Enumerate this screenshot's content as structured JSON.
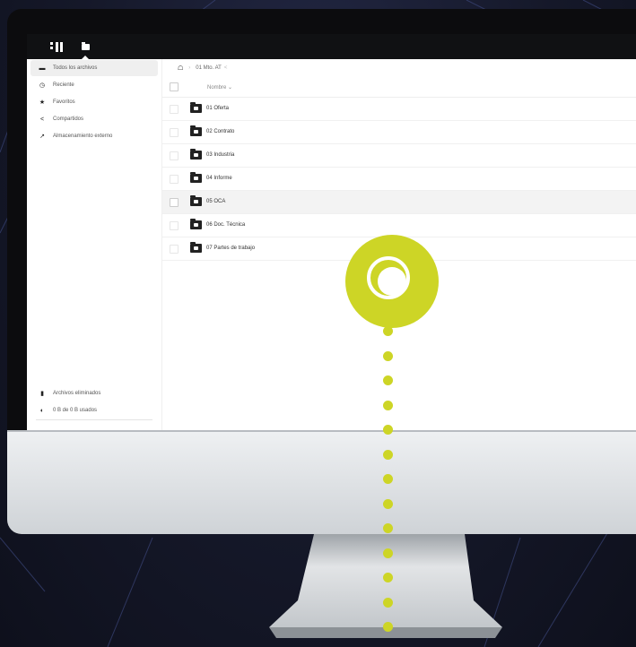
{
  "sidebar": {
    "items": [
      {
        "label": "Todos los archivos",
        "icon": "folder-icon",
        "active": true
      },
      {
        "label": "Reciente",
        "icon": "clock-icon"
      },
      {
        "label": "Favoritos",
        "icon": "star-icon"
      },
      {
        "label": "Compartidos",
        "icon": "share-icon"
      },
      {
        "label": "Almacenamiento externo",
        "icon": "external-icon"
      }
    ],
    "trash_label": "Archivos eliminados",
    "quota_label": "0 B de 0 B usados"
  },
  "breadcrumb": {
    "current": "01 Mto. AT"
  },
  "table": {
    "name_header": "Nombre",
    "rows": [
      {
        "name": "01 Oferta"
      },
      {
        "name": "02 Contrato"
      },
      {
        "name": "03 Industria"
      },
      {
        "name": "04 Informe"
      },
      {
        "name": "05 OCA",
        "highlighted": true
      },
      {
        "name": "06 Doc. Técnica"
      },
      {
        "name": "07 Partes de trabajo"
      }
    ]
  },
  "colors": {
    "accent": "#cdd526",
    "topbar": "#101113"
  }
}
